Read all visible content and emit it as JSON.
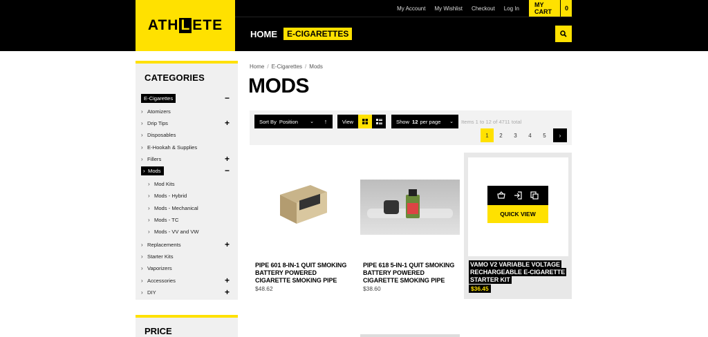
{
  "logo": {
    "pre": "ATH",
    "box": "L",
    "post": "ETE"
  },
  "top_links": [
    "My Account",
    "My Wishlist",
    "Checkout",
    "Log In"
  ],
  "cart": {
    "label": "MY CART",
    "count": "0"
  },
  "nav": {
    "home": "HOME",
    "active": "E-CIGARETTES"
  },
  "sidebar": {
    "title": "CATEGORIES",
    "items": [
      {
        "label": "E-Cigarettes",
        "toggle": "−"
      },
      {
        "label": "Atomizers",
        "toggle": ""
      },
      {
        "label": "Drip Tips",
        "toggle": "+"
      },
      {
        "label": "Disposables",
        "toggle": ""
      },
      {
        "label": "E-Hookah & Supplies",
        "toggle": ""
      },
      {
        "label": "Fillers",
        "toggle": "+"
      },
      {
        "label": "Mods",
        "toggle": "−"
      },
      {
        "label": "Mod Kits",
        "toggle": ""
      },
      {
        "label": "Mods - Hybrid",
        "toggle": ""
      },
      {
        "label": "Mods - Mechanical",
        "toggle": ""
      },
      {
        "label": "Mods - TC",
        "toggle": ""
      },
      {
        "label": "Mods - VV and VW",
        "toggle": ""
      },
      {
        "label": "Replacements",
        "toggle": "+"
      },
      {
        "label": "Starter Kits",
        "toggle": ""
      },
      {
        "label": "Vaporizers",
        "toggle": ""
      },
      {
        "label": "Accessories",
        "toggle": "+"
      },
      {
        "label": "DIY",
        "toggle": "+"
      }
    ],
    "price_title": "PRICE"
  },
  "breadcrumb": [
    "Home",
    "E-Cigarettes",
    "Mods"
  ],
  "page_title": "MODS",
  "toolbar": {
    "sort_label": "Sort By",
    "sort_value": "Position",
    "sort_dir": "↑",
    "view_label": "View",
    "show_label": "Show",
    "show_value": "12",
    "show_suffix": "per page",
    "items_total": "Items 1 to 12 of 4711 total",
    "pages": [
      "1",
      "2",
      "3",
      "4",
      "5"
    ],
    "next": "›"
  },
  "products": [
    {
      "name": "PIPE 601 8-IN-1 QUIT SMOKING BATTERY POWERED CIGARETTE SMOKING PIPE",
      "price": "$48.62"
    },
    {
      "name": "PIPE 618 5-IN-1 QUIT SMOKING BATTERY POWERED CIGARETTE SMOKING PIPE",
      "price": "$38.60"
    },
    {
      "name": "VAMO V2 VARIABLE VOLTAGE RECHARGEABLE E-CIGARETTE STARTER KIT",
      "price": "$36.45"
    }
  ],
  "quick_view": "QUICK VIEW",
  "colors": {
    "accent": "#ffe100",
    "dark": "#000000"
  }
}
